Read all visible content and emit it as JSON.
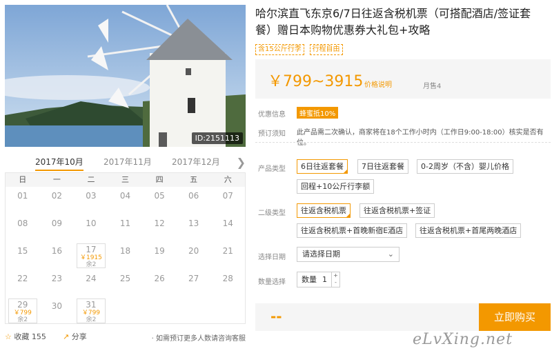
{
  "photo": {
    "id_label": "ID:2151113"
  },
  "calendar": {
    "months": [
      "2017年10月",
      "2017年11月",
      "2017年12月"
    ],
    "active_month_index": 0,
    "weekdays": [
      "日",
      "一",
      "二",
      "三",
      "四",
      "五",
      "六"
    ],
    "weeks": [
      [
        {
          "d": "01"
        },
        {
          "d": "02"
        },
        {
          "d": "03"
        },
        {
          "d": "04"
        },
        {
          "d": "05"
        },
        {
          "d": "06"
        },
        {
          "d": "07"
        }
      ],
      [
        {
          "d": "08"
        },
        {
          "d": "09"
        },
        {
          "d": "10"
        },
        {
          "d": "11"
        },
        {
          "d": "12"
        },
        {
          "d": "13"
        },
        {
          "d": "14"
        }
      ],
      [
        {
          "d": "15"
        },
        {
          "d": "16"
        },
        {
          "d": "17",
          "price": "￥1915",
          "remain": "余2"
        },
        {
          "d": "18"
        },
        {
          "d": "19"
        },
        {
          "d": "20"
        },
        {
          "d": "21"
        }
      ],
      [
        {
          "d": "22"
        },
        {
          "d": "23"
        },
        {
          "d": "24"
        },
        {
          "d": "25"
        },
        {
          "d": "26"
        },
        {
          "d": "27"
        },
        {
          "d": "28"
        }
      ],
      [
        {
          "d": "29",
          "price": "￥799",
          "remain": "余2"
        },
        {
          "d": "30"
        },
        {
          "d": "31",
          "price": "￥799",
          "remain": "余2"
        },
        {
          "d": ""
        },
        {
          "d": ""
        },
        {
          "d": ""
        },
        {
          "d": ""
        }
      ]
    ]
  },
  "actions": {
    "favorite": "收藏",
    "favorite_count": "155",
    "share": "分享",
    "consult": "· 如需预订更多人数请咨询客服"
  },
  "product": {
    "title": "哈尔滨直飞东京6/7日往返含税机票（可搭配酒店/签证套餐）赠日本购物优惠券大礼包+攻略",
    "tags": [
      "含15公斤行李",
      "行程自由"
    ],
    "price": "￥799~3915",
    "price_note": "价格说明",
    "monthly_sales": "月售4"
  },
  "promo": {
    "label": "优惠信息",
    "badge": "蜂蜜抵10%"
  },
  "notice": {
    "label": "预订须知",
    "text": "此产品需二次确认，商家将在18个工作小时内（工作日9:00-18:00）核实是否有位。"
  },
  "options": {
    "type_label": "产品类型",
    "types": [
      "6日往返套餐",
      "7日往返套餐",
      "0-2周岁（不含）婴儿价格",
      "回程+10公斤行李额"
    ],
    "sub_label": "二级类型",
    "subs": [
      "往返含税机票",
      "往返含税机票+签证",
      "往返含税机票+首晚新宿E酒店",
      "往返含税机票+首尾两晚酒店"
    ]
  },
  "date": {
    "label": "选择日期",
    "placeholder": "请选择日期"
  },
  "quantity": {
    "label": "数量选择",
    "prefix": "数量",
    "value": "1"
  },
  "buy": {
    "dash": "--",
    "button": "立即购买"
  },
  "watermark": "eLvXing.net",
  "colors": {
    "accent": "#f39800",
    "sky": "#8fb6df",
    "sea": "#5e8fbd"
  }
}
